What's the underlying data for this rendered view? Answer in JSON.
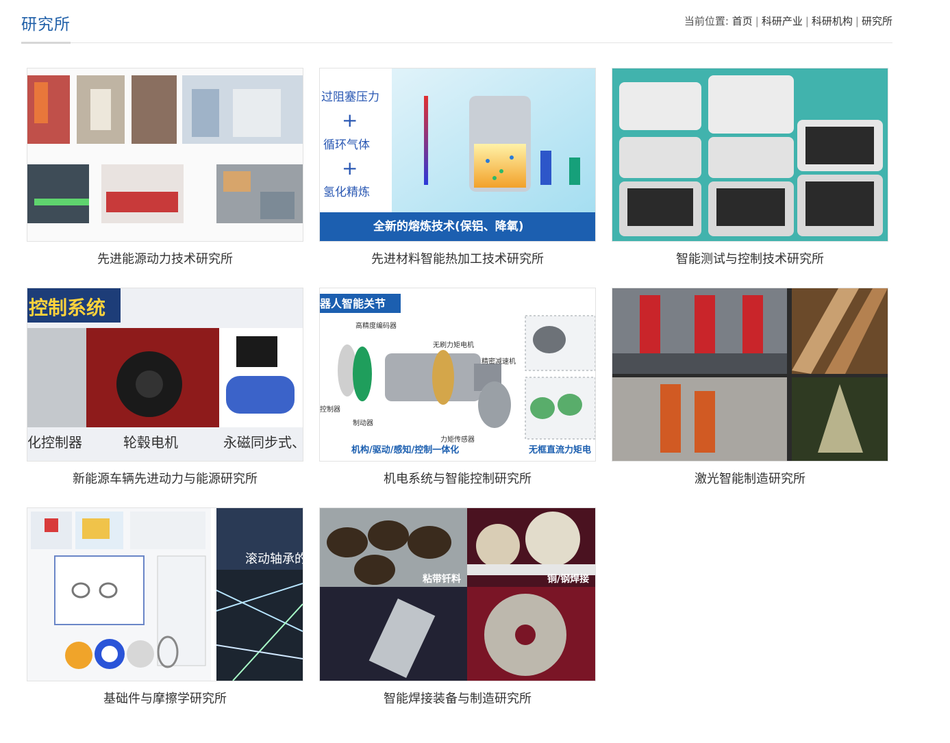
{
  "header": {
    "title": "研究所",
    "breadcrumb_prefix": "当前位置:",
    "breadcrumb": [
      "首页",
      "科研产业",
      "科研机构",
      "研究所"
    ],
    "separator": "|"
  },
  "institutes": [
    {
      "name": "先进能源动力技术研究所"
    },
    {
      "name": "先进材料智能热加工技术研究所",
      "image_text": [
        "过阻塞压力",
        "+",
        "循环气体",
        "+",
        "氢化精炼",
        "全新的熔炼技术(保铝、降氧)"
      ]
    },
    {
      "name": "智能测试与控制技术研究所"
    },
    {
      "name": "新能源车辆先进动力与能源研究所",
      "image_text": [
        "控制系统",
        "化控制器",
        "轮毂电机",
        "永磁同步式、"
      ]
    },
    {
      "name": "机电系统与智能控制研究所",
      "image_text": [
        "器人智能关节",
        "高精度编码器",
        "无刷力矩电机",
        "精密减速机",
        "控制器",
        "制动器",
        "力矩传感器",
        "机构/驱动/感知/控制一体化",
        "无框直流力矩电"
      ]
    },
    {
      "name": "激光智能制造研究所"
    },
    {
      "name": "基础件与摩擦学研究所",
      "image_text": [
        "滚动轴承的"
      ]
    },
    {
      "name": "智能焊接装备与制造研究所",
      "image_text": [
        "粘带钎料",
        "铜/钢焊接"
      ]
    }
  ],
  "colors": {
    "title_blue": "#1f5fa8",
    "text": "#333333",
    "border": "#e2e2e2"
  }
}
